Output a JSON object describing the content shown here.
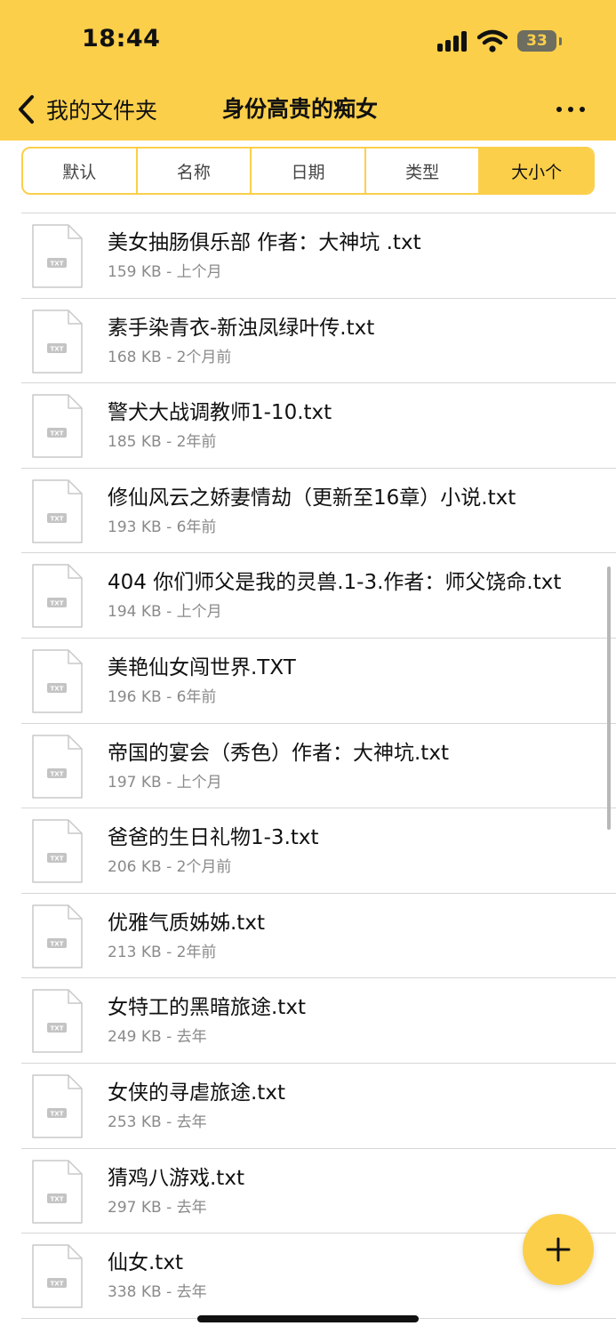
{
  "status_bar": {
    "time": "18:44",
    "battery": "33"
  },
  "nav": {
    "back_label": "我的文件夹",
    "title": "身份高贵的痴女"
  },
  "sort_tabs": [
    {
      "label": "默认"
    },
    {
      "label": "名称"
    },
    {
      "label": "日期"
    },
    {
      "label": "类型"
    },
    {
      "label": "大小个"
    }
  ],
  "active_sort": "大小个",
  "icon_label": "TXT",
  "files": [
    {
      "name": "美女抽肠俱乐部  作者：大神坑 .txt",
      "meta": "159 KB - 上个月"
    },
    {
      "name": "素手染青衣-新浊凤绿叶传.txt",
      "meta": "168 KB - 2个月前"
    },
    {
      "name": "警犬大战调教师1-10.txt",
      "meta": "185 KB - 2年前"
    },
    {
      "name": "修仙风云之娇妻情劫（更新至16章）小说.txt",
      "meta": "193 KB - 6年前"
    },
    {
      "name": "404 你们师父是我的灵兽.1-3.作者：师父饶命.txt",
      "meta": "194 KB - 上个月"
    },
    {
      "name": "美艳仙女闯世界.TXT",
      "meta": "196 KB - 6年前"
    },
    {
      "name": "帝国的宴会（秀色）作者：大神坑.txt",
      "meta": "197 KB - 上个月"
    },
    {
      "name": "爸爸的生日礼物1-3.txt",
      "meta": "206 KB - 2个月前"
    },
    {
      "name": "优雅气质姊姊.txt",
      "meta": "213 KB - 2年前"
    },
    {
      "name": "女特工的黑暗旅途.txt",
      "meta": "249 KB - 去年"
    },
    {
      "name": "女侠的寻虐旅途.txt",
      "meta": "253 KB - 去年"
    },
    {
      "name": "猜鸡八游戏.txt",
      "meta": "297 KB - 去年"
    },
    {
      "name": "仙女.txt",
      "meta": "338 KB - 去年"
    }
  ]
}
